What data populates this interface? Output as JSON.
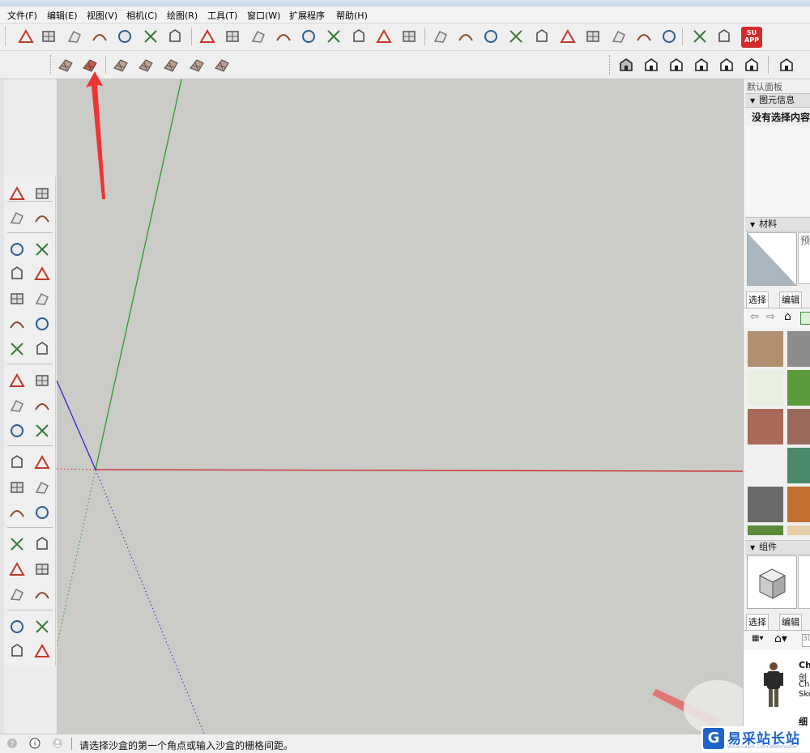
{
  "menu": [
    "文件(F)",
    "编辑(E)",
    "视图(V)",
    "相机(C)",
    "绘图(R)",
    "工具(T)",
    "窗口(W)",
    "扩展程序",
    "帮助(H)"
  ],
  "toolbar": {
    "row1_icons": [
      "smart-push-icon",
      "smart-offset-icon",
      "subdivide-icon",
      "grid-icon",
      "pillars-icon",
      "slice-icon",
      "lines-icon",
      "line-tool-icon",
      "curve-icon",
      "arc-check-icon",
      "roof-icon",
      "panel-icon",
      "flip-icon",
      "polyline-icon",
      "chevron-icon",
      "eraser-icon",
      "stamp-icon",
      "pyramid-icon",
      "drape-icon",
      "bend-icon",
      "box-icon",
      "component-icon",
      "inspect-icon",
      "gate-icon",
      "pin-icon",
      "knife-icon",
      "3b-logo-icon",
      "sketchup-red-icon"
    ],
    "su_app_label": "SU APP",
    "sandbox_icons": [
      "sandbox-from-contours-icon",
      "sandbox-from-scratch-icon",
      "smoove-icon",
      "stamp-terrain-icon",
      "drape-terrain-icon",
      "add-detail-icon",
      "flip-edge-icon"
    ],
    "view_icons": [
      "iso-view-icon",
      "top-view-icon",
      "front-view-icon",
      "right-view-icon",
      "back-view-icon",
      "left-view-icon",
      "section-icon"
    ]
  },
  "left_tools": [
    [
      "select-arrow-icon",
      "component-make-icon"
    ],
    [
      "paint-bucket-icon",
      "eraser-tool-icon"
    ],
    [
      "pencil-icon",
      "freehand-icon"
    ],
    [
      "rectangle-icon",
      "rotated-rectangle-icon"
    ],
    [
      "circle-icon",
      "polygon-icon"
    ],
    [
      "arc-icon",
      "two-point-arc-icon"
    ],
    [
      "three-point-arc-icon",
      "pie-icon"
    ],
    [
      "move-icon",
      "push-pull-icon"
    ],
    [
      "rotate-icon",
      "follow-me-icon"
    ],
    [
      "scale-icon",
      "offset-icon"
    ],
    [
      "tape-measure-icon",
      "dimension-icon"
    ],
    [
      "protractor-icon",
      "text-label-icon"
    ],
    [
      "axes-icon",
      "3d-text-icon"
    ],
    [
      "orbit-icon",
      "pan-icon"
    ],
    [
      "zoom-icon",
      "zoom-window-icon"
    ],
    [
      "zoom-extents-icon",
      "previous-view-icon"
    ],
    [
      "position-camera-icon",
      "look-around-icon"
    ],
    [
      "walk-icon",
      "section-plane-icon"
    ]
  ],
  "tray": {
    "title": "默认面板",
    "entity_info": {
      "header": "图元信息",
      "empty": "没有选择内容"
    },
    "materials": {
      "header": "材料",
      "preview_hint": "预",
      "tab_select": "选择",
      "tab_edit": "编辑"
    },
    "components": {
      "header": "组件",
      "tab_select": "选择",
      "tab_edit": "编辑",
      "search_stub": "3D",
      "item_name": "Ch",
      "item_desc1": "创",
      "item_desc2": "Ch",
      "item_desc3": "Ske",
      "next_item": "细"
    }
  },
  "status": {
    "message": "请选择沙盒的第一个角点或输入沙盒的栅格间距。"
  },
  "watermark": {
    "text": "易采站长站",
    "sub": "Www.Easck.Com  Webmaster",
    "logo_letter": "G"
  },
  "colors": {
    "viewport": "#cbcbc7",
    "axis_red": "#cc2222",
    "axis_green": "#2e9a2e",
    "axis_blue": "#2a2acc",
    "annotation_arrow": "#ee3333"
  }
}
